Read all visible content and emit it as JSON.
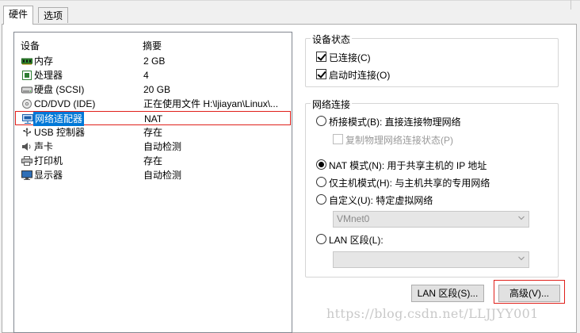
{
  "tabs": [
    {
      "label": "硬件",
      "active": true
    },
    {
      "label": "选项",
      "active": false
    }
  ],
  "device_list": {
    "header_device": "设备",
    "header_summary": "摘要",
    "rows": [
      {
        "name": "内存",
        "summary": "2 GB",
        "icon": "memory-icon"
      },
      {
        "name": "处理器",
        "summary": "4",
        "icon": "processor-icon"
      },
      {
        "name": "硬盘 (SCSI)",
        "summary": "20 GB",
        "icon": "harddisk-icon"
      },
      {
        "name": "CD/DVD (IDE)",
        "summary": "正在使用文件 H:\\ljiayan\\Linux\\...",
        "icon": "cd-dvd-icon"
      },
      {
        "name": "网络适配器",
        "summary": "NAT",
        "icon": "network-adapter-icon",
        "selected": true
      },
      {
        "name": "USB 控制器",
        "summary": "存在",
        "icon": "usb-icon"
      },
      {
        "name": "声卡",
        "summary": "自动检测",
        "icon": "sound-card-icon"
      },
      {
        "name": "打印机",
        "summary": "存在",
        "icon": "printer-icon"
      },
      {
        "name": "显示器",
        "summary": "自动检测",
        "icon": "display-icon"
      }
    ]
  },
  "device_status": {
    "title": "设备状态",
    "connected": {
      "label": "已连接(C)",
      "checked": true
    },
    "connect_at_power_on": {
      "label": "启动时连接(O)",
      "checked": true
    }
  },
  "network_connection": {
    "title": "网络连接",
    "bridged": {
      "label": "桥接模式(B): 直接连接物理网络",
      "selected": false
    },
    "replicate": {
      "label": "复制物理网络连接状态(P)",
      "checked": false,
      "disabled": true
    },
    "nat": {
      "label": "NAT 模式(N): 用于共享主机的 IP 地址",
      "selected": true
    },
    "host_only": {
      "label": "仅主机模式(H): 与主机共享的专用网络",
      "selected": false
    },
    "custom": {
      "label": "自定义(U): 特定虚拟网络",
      "selected": false
    },
    "custom_select_value": "VMnet0",
    "lan_segment": {
      "label": "LAN 区段(L):",
      "selected": false
    },
    "lan_select_value": ""
  },
  "buttons": {
    "lan_segments": "LAN 区段(S)...",
    "advanced": "高级(V)..."
  },
  "watermark": "https://blog.csdn.net/LLJJYY001",
  "colors": {
    "selection": "#0078d7",
    "highlight_border": "#e0201b"
  }
}
